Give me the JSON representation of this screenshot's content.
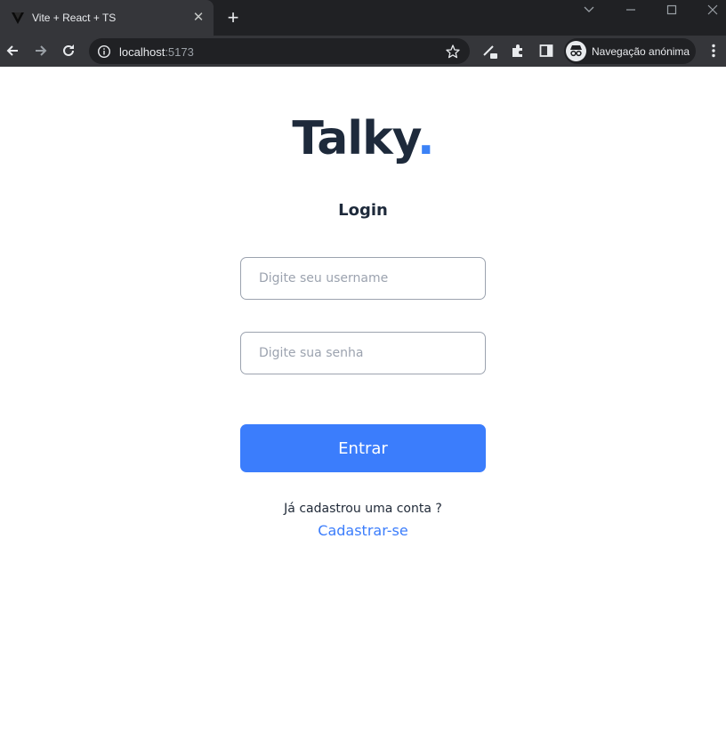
{
  "browser": {
    "tab": {
      "title": "Vite + React + TS",
      "favicon": "vite-icon"
    },
    "address": {
      "host": "localhost",
      "port": ":5173"
    },
    "profile": {
      "label": "Navegação anónima",
      "icon": "incognito-icon"
    }
  },
  "page": {
    "brand": {
      "name": "Talky",
      "dot": "."
    },
    "heading": "Login",
    "username": {
      "placeholder": "Digite seu username",
      "value": ""
    },
    "password": {
      "placeholder": "Digite sua senha",
      "value": ""
    },
    "submit_label": "Entrar",
    "question": "Já cadastrou uma conta ?",
    "signup_link": "Cadastrar-se"
  },
  "colors": {
    "brand_dark": "#1e2a3b",
    "accent": "#3b7dfc",
    "chrome_dark": "#202124",
    "chrome_toolbar": "#35363a"
  }
}
